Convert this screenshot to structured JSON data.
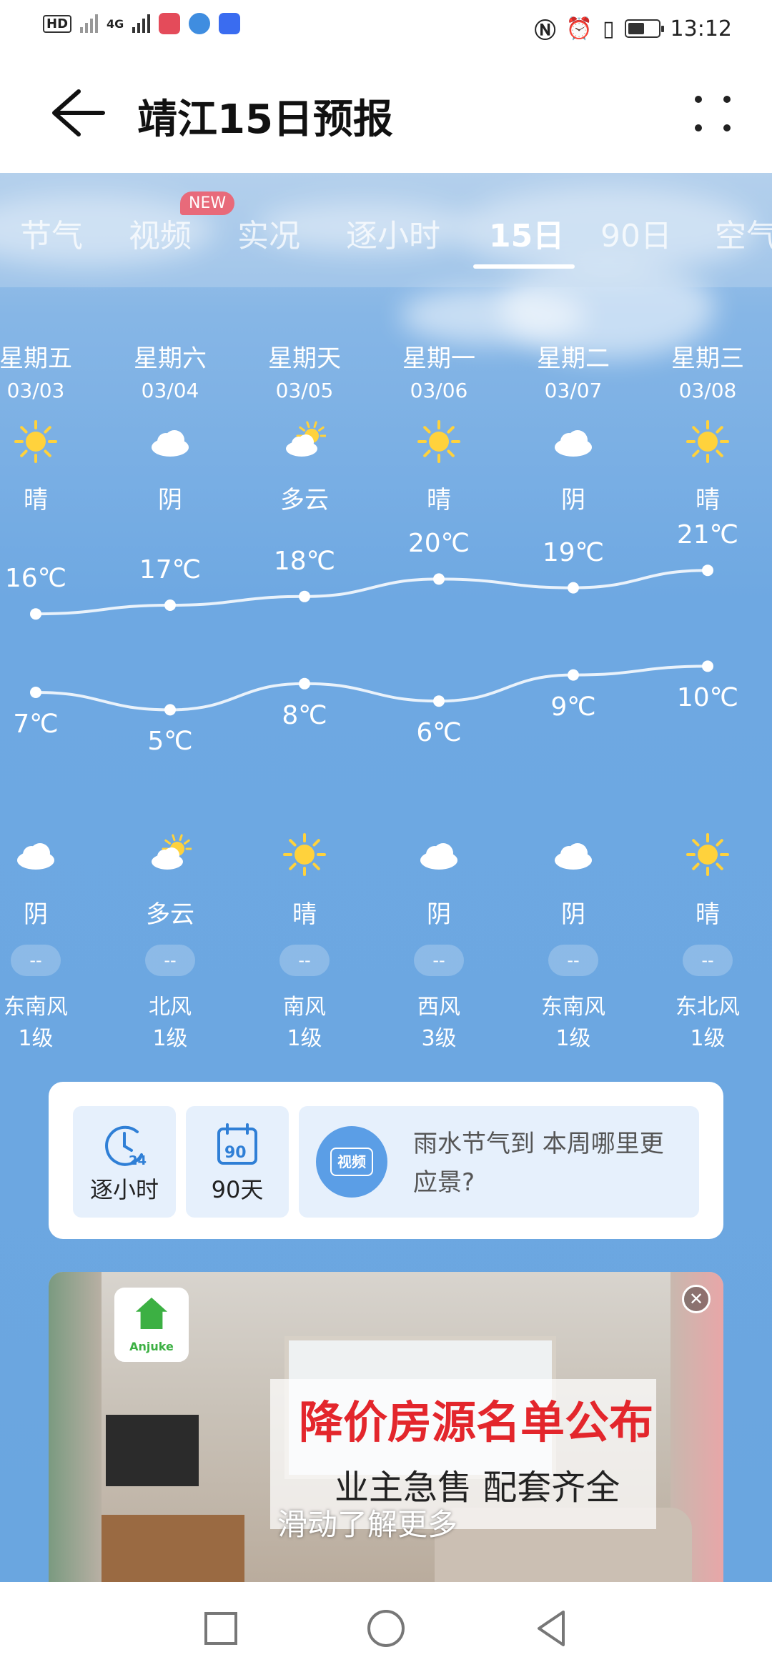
{
  "status_bar": {
    "badge_hd": "HD",
    "badge_4g": "4G",
    "time": "13:12",
    "battery_level": 0.55
  },
  "header": {
    "title": "靖江15日预报"
  },
  "tabs": {
    "items": [
      "节气",
      "视频",
      "实况",
      "逐小时",
      "15日",
      "90日",
      "空气"
    ],
    "active": "15日",
    "new_badge": "NEW"
  },
  "days": [
    {
      "week": "星期五",
      "date": "03/03",
      "day_icon": "sun-icon",
      "day_weather": "晴",
      "high": "16℃",
      "low": "7℃",
      "night_icon": "cloud-icon",
      "night_weather": "阴",
      "aqi": "--",
      "wind_dir": "东南风",
      "wind_level": "1级"
    },
    {
      "week": "星期六",
      "date": "03/04",
      "day_icon": "cloud-icon",
      "day_weather": "阴",
      "high": "17℃",
      "low": "5℃",
      "night_icon": "partly-cloudy-icon",
      "night_weather": "多云",
      "aqi": "--",
      "wind_dir": "北风",
      "wind_level": "1级"
    },
    {
      "week": "星期天",
      "date": "03/05",
      "day_icon": "partly-cloudy-icon",
      "day_weather": "多云",
      "high": "18℃",
      "low": "8℃",
      "night_icon": "sun-icon",
      "night_weather": "晴",
      "aqi": "--",
      "wind_dir": "南风",
      "wind_level": "1级"
    },
    {
      "week": "星期一",
      "date": "03/06",
      "day_icon": "sun-icon",
      "day_weather": "晴",
      "high": "20℃",
      "low": "6℃",
      "night_icon": "cloud-icon",
      "night_weather": "阴",
      "aqi": "--",
      "wind_dir": "西风",
      "wind_level": "3级"
    },
    {
      "week": "星期二",
      "date": "03/07",
      "day_icon": "cloud-icon",
      "day_weather": "阴",
      "high": "19℃",
      "low": "9℃",
      "night_icon": "cloud-icon",
      "night_weather": "阴",
      "aqi": "--",
      "wind_dir": "东南风",
      "wind_level": "1级"
    },
    {
      "week": "星期三",
      "date": "03/08",
      "day_icon": "sun-icon",
      "day_weather": "晴",
      "high": "21℃",
      "low": "10℃",
      "night_icon": "sun-icon",
      "night_weather": "晴",
      "aqi": "--",
      "wind_dir": "东北风",
      "wind_level": "1级"
    }
  ],
  "chart_data": {
    "type": "line",
    "categories": [
      "03/03",
      "03/04",
      "03/05",
      "03/06",
      "03/07",
      "03/08"
    ],
    "series": [
      {
        "values": [
          16,
          17,
          18,
          20,
          19,
          21
        ]
      },
      {
        "values": [
          7,
          5,
          8,
          6,
          9,
          10
        ]
      }
    ]
  },
  "shortcuts": {
    "hourly_label": "逐小时",
    "hourly_icon_text": "24",
    "days90_label": "90天",
    "days90_icon_text": "90",
    "video_badge": "视频",
    "video_text": "雨水节气到 本周哪里更应景?"
  },
  "ad": {
    "brand": "Anjuke",
    "headline": "降价房源名单公布",
    "subline": "业主急售 配套齐全",
    "cta": "滑动了解更多"
  },
  "colors": {
    "sky": "#6aa8de",
    "ad_headline": "#e3262c",
    "new_badge": "#e86a7a",
    "video_icon": "#5b9ee6"
  }
}
